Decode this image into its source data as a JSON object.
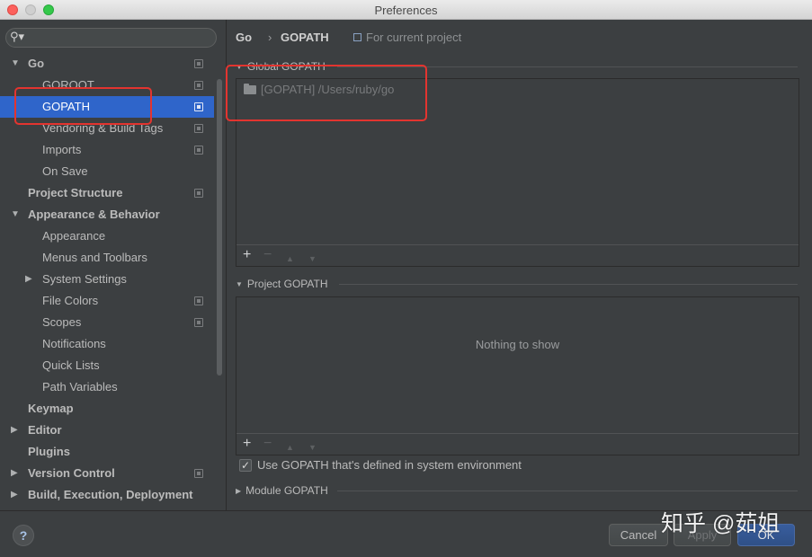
{
  "window": {
    "title": "Preferences"
  },
  "sidebar": {
    "search_value": "",
    "items": [
      {
        "label": "Go",
        "level": 0,
        "arrow": "▼",
        "bold": true,
        "project_icon": true,
        "selected": false
      },
      {
        "label": "GOROOT",
        "level": 1,
        "arrow": "",
        "bold": false,
        "project_icon": true,
        "selected": false
      },
      {
        "label": "GOPATH",
        "level": 1,
        "arrow": "",
        "bold": false,
        "project_icon": true,
        "selected": true
      },
      {
        "label": "Vendoring & Build Tags",
        "level": 1,
        "arrow": "",
        "bold": false,
        "project_icon": true,
        "selected": false
      },
      {
        "label": "Imports",
        "level": 1,
        "arrow": "",
        "bold": false,
        "project_icon": true,
        "selected": false
      },
      {
        "label": "On Save",
        "level": 1,
        "arrow": "",
        "bold": false,
        "project_icon": false,
        "selected": false
      },
      {
        "label": "Project Structure",
        "level": 0,
        "arrow": "",
        "bold": true,
        "project_icon": true,
        "selected": false
      },
      {
        "label": "Appearance & Behavior",
        "level": 0,
        "arrow": "▼",
        "bold": true,
        "project_icon": false,
        "selected": false
      },
      {
        "label": "Appearance",
        "level": 1,
        "arrow": "",
        "bold": false,
        "project_icon": false,
        "selected": false
      },
      {
        "label": "Menus and Toolbars",
        "level": 1,
        "arrow": "",
        "bold": false,
        "project_icon": false,
        "selected": false
      },
      {
        "label": "System Settings",
        "level": 1,
        "arrow": "▶",
        "bold": false,
        "project_icon": false,
        "selected": false
      },
      {
        "label": "File Colors",
        "level": 1,
        "arrow": "",
        "bold": false,
        "project_icon": true,
        "selected": false
      },
      {
        "label": "Scopes",
        "level": 1,
        "arrow": "",
        "bold": false,
        "project_icon": true,
        "selected": false
      },
      {
        "label": "Notifications",
        "level": 1,
        "arrow": "",
        "bold": false,
        "project_icon": false,
        "selected": false
      },
      {
        "label": "Quick Lists",
        "level": 1,
        "arrow": "",
        "bold": false,
        "project_icon": false,
        "selected": false
      },
      {
        "label": "Path Variables",
        "level": 1,
        "arrow": "",
        "bold": false,
        "project_icon": false,
        "selected": false
      },
      {
        "label": "Keymap",
        "level": 0,
        "arrow": "",
        "bold": true,
        "project_icon": false,
        "selected": false
      },
      {
        "label": "Editor",
        "level": 0,
        "arrow": "▶",
        "bold": true,
        "project_icon": false,
        "selected": false
      },
      {
        "label": "Plugins",
        "level": 0,
        "arrow": "",
        "bold": true,
        "project_icon": false,
        "selected": false
      },
      {
        "label": "Version Control",
        "level": 0,
        "arrow": "▶",
        "bold": true,
        "project_icon": true,
        "selected": false
      },
      {
        "label": "Build, Execution, Deployment",
        "level": 0,
        "arrow": "▶",
        "bold": true,
        "project_icon": false,
        "selected": false
      }
    ]
  },
  "breadcrumb": {
    "parent": "Go",
    "separator": "›",
    "current": "GOPATH",
    "scope": "For current project"
  },
  "global_gopath": {
    "title": "Global GOPATH",
    "entries": [
      "[GOPATH] /Users/ruby/go"
    ]
  },
  "project_gopath": {
    "title": "Project GOPATH",
    "empty_text": "Nothing to show"
  },
  "use_system_gopath": {
    "label": "Use GOPATH that's defined in system environment",
    "checked": true,
    "mark": "✓"
  },
  "module_gopath": {
    "title": "Module GOPATH"
  },
  "toolbar_icons": {
    "add": "+",
    "remove": "−",
    "up": "▲",
    "down": "▼"
  },
  "buttons": {
    "help": "?",
    "cancel": "Cancel",
    "apply": "Apply",
    "ok": "OK"
  },
  "watermark": "知乎 @茹姐",
  "colors": {
    "selection": "#2f65ca",
    "annotation": "#e3342f",
    "background": "#3c3f41"
  }
}
